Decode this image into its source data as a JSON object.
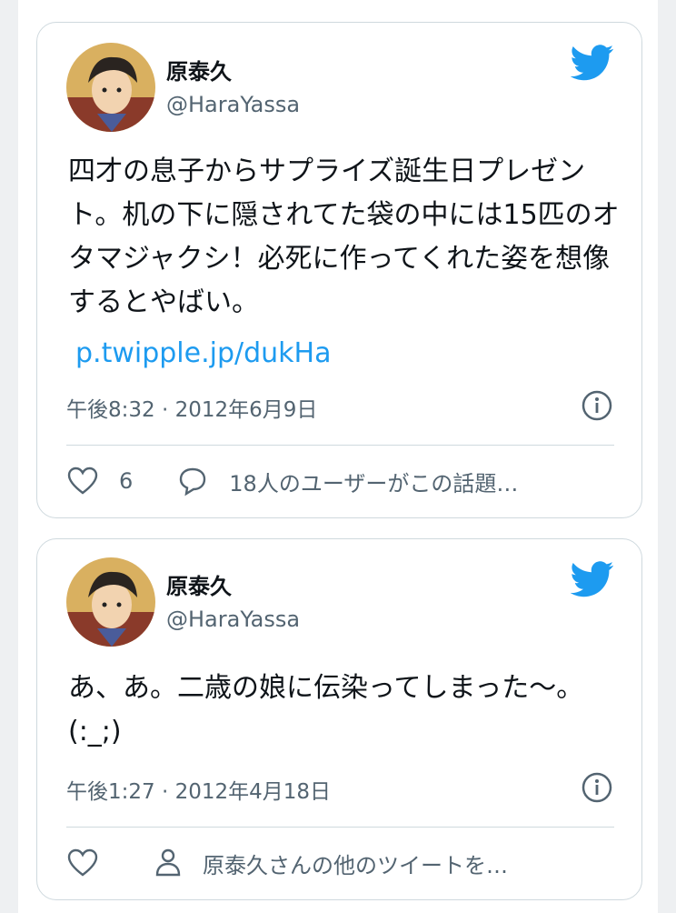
{
  "tweets": [
    {
      "author_name": "原泰久",
      "handle": "@HaraYassa",
      "text": "四才の息子からサプライズ誕生日プレゼント。机の下に隠されてた袋の中には15匹のオタマジャクシ！必死に作ってくれた姿を想像するとやばい。",
      "link": "p.twipple.jp/dukHa",
      "timestamp": "午後8:32 · 2012年6月9日",
      "like_count": "6",
      "reply_text": "18人のユーザーがこの話題…"
    },
    {
      "author_name": "原泰久",
      "handle": "@HaraYassa",
      "text": "あ、あ。二歳の娘に伝染ってしまった〜。(:_;)",
      "timestamp": "午後1:27 · 2012年4月18日",
      "more_text": "原泰久さんの他のツイートを…"
    }
  ],
  "colors": {
    "twitter_blue": "#1d9bf0",
    "secondary_text": "#536471",
    "border": "#cfd9de"
  },
  "icons": [
    "twitter-bird-icon",
    "info-icon",
    "heart-icon",
    "reply-bubble-icon",
    "person-icon"
  ]
}
